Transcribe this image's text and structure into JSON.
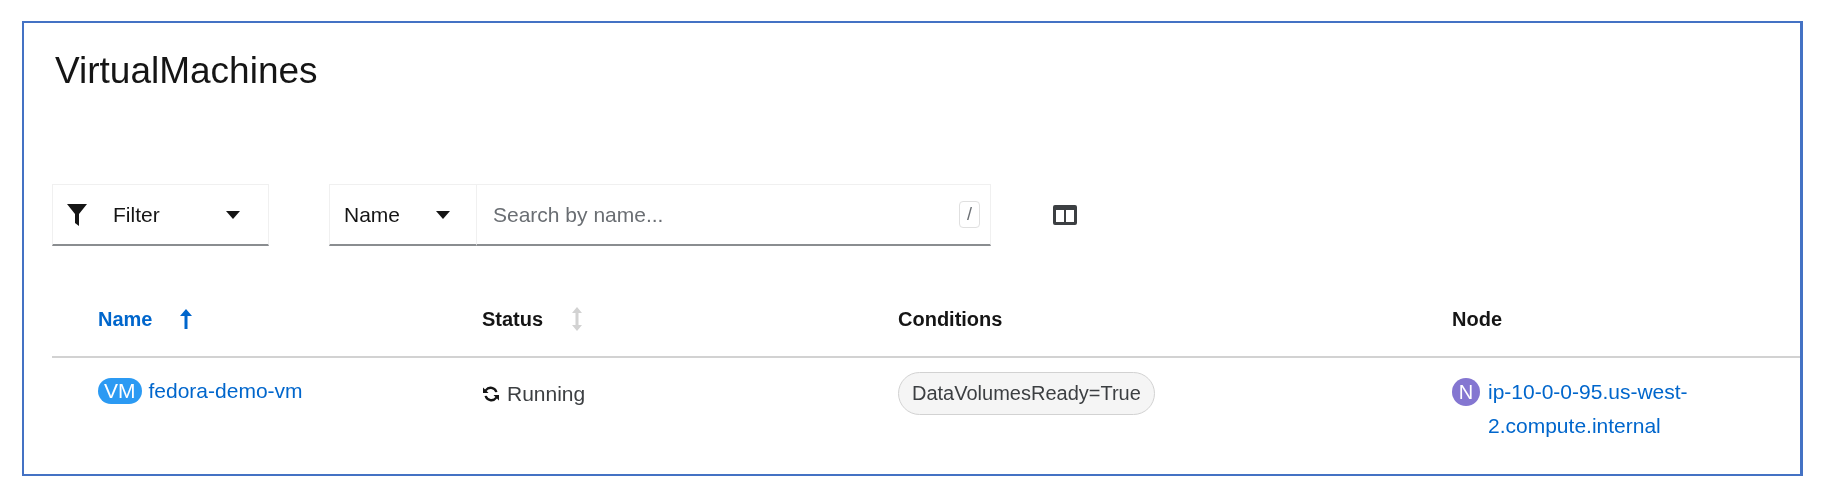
{
  "title": "VirtualMachines",
  "toolbar": {
    "filter": {
      "label": "Filter"
    },
    "attribute": {
      "label": "Name"
    },
    "search": {
      "placeholder": "Search by name...",
      "shortcut": "/"
    }
  },
  "table": {
    "columns": [
      {
        "label": "Name",
        "sortable": true,
        "sorted": true
      },
      {
        "label": "Status",
        "sortable": true,
        "sorted": false
      },
      {
        "label": "Conditions",
        "sortable": false,
        "sorted": false
      },
      {
        "label": "Node",
        "sortable": false,
        "sorted": false
      }
    ],
    "rows": [
      {
        "badge": "VM",
        "name": "fedora-demo-vm",
        "status": "Running",
        "conditions": [
          "DataVolumesReady=True"
        ],
        "node_badge": "N",
        "node": "ip-10-0-0-95.us-west-2.compute.internal"
      }
    ]
  }
}
